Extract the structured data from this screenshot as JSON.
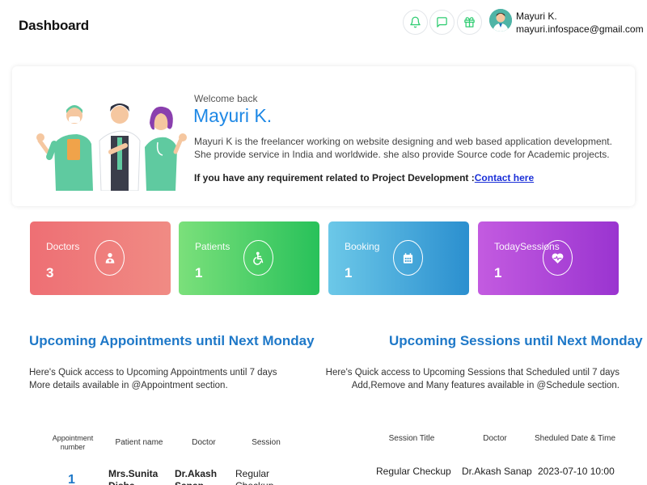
{
  "header": {
    "title": "Dashboard",
    "user_name": "Mayuri K.",
    "user_email": "mayuri.infospace@gmail.com"
  },
  "icons": [
    "bell-icon",
    "chat-icon",
    "gift-icon"
  ],
  "welcome": {
    "greeting": "Welcome back",
    "name": "Mayuri K.",
    "description": "Mayuri K is the freelancer working on website designing and web based application development. She provide service in India and worldwide. she also provide Source code for Academic projects.",
    "requirement_text": "If you have any requirement related to Project Development :",
    "contact_link": "Contact here"
  },
  "stats": [
    {
      "label": "Doctors",
      "value": "3",
      "icon": "doctor-icon",
      "color_from": "#ee6f74",
      "color_to": "#f08b84"
    },
    {
      "label": "Patients",
      "value": "1",
      "icon": "wheelchair-icon",
      "color_from": "#7be07b",
      "color_to": "#28c15a"
    },
    {
      "label": "Booking",
      "value": "1",
      "icon": "calendar-icon",
      "color_from": "#6cc8e8",
      "color_to": "#2b8fcf"
    },
    {
      "label": "TodaySessions",
      "value": "1",
      "icon": "heart-pulse-icon",
      "color_from": "#c35be0",
      "color_to": "#9a34d0"
    }
  ],
  "appointments": {
    "title": "Upcoming Appointments until Next Monday",
    "desc_line1": "Here's Quick access to Upcoming Appointments until 7 days",
    "desc_line2": "More details available in @Appointment section.",
    "columns": [
      "Appointment number",
      "Patient name",
      "Doctor",
      "Session"
    ],
    "rows": [
      {
        "number": "1",
        "patient": "Mrs.Sunita Disha",
        "doctor": "Dr.Akash Sanap",
        "session": "Regular Checkup"
      }
    ]
  },
  "sessions": {
    "title": "Upcoming Sessions until Next Monday",
    "desc_line1": "Here's Quick access to Upcoming Sessions that Scheduled until 7 days",
    "desc_line2": "Add,Remove and Many features available in @Schedule section.",
    "columns": [
      "Session Title",
      "Doctor",
      "Sheduled Date & Time"
    ],
    "rows": [
      {
        "title": "Regular Checkup",
        "doctor": "Dr.Akash Sanap",
        "datetime": "2023-07-10 10:00"
      }
    ]
  }
}
